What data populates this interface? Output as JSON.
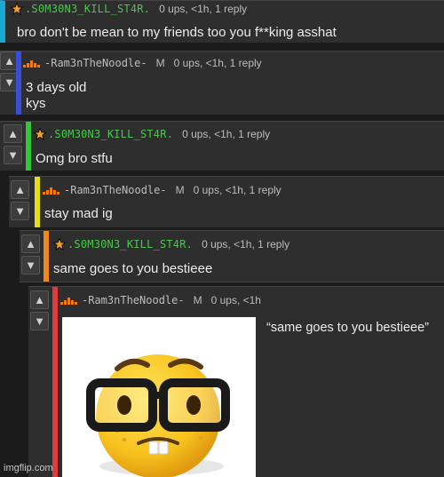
{
  "colors": {
    "bg": "#1b1b1b",
    "panel": "#2e2e2e",
    "blue": "#1aa7d1",
    "indigo": "#3a4fd6",
    "green": "#33c53a",
    "yellow": "#e5dc1a",
    "orange": "#f08a1c",
    "red": "#e23b3b",
    "username_green": "#45c94a"
  },
  "comments": [
    {
      "username": ".S0M30N3_KILL_ST4R.",
      "stats": "0 ups, <1h, 1 reply",
      "text": "bro don't be mean to my friends too you f**king asshat",
      "user_icon": "star-icon"
    },
    {
      "username": "-Ram3nTheNoodle-",
      "mod": "M",
      "stats": "0 ups, <1h, 1 reply",
      "text_line1": "3 days old",
      "text_line2": "kys",
      "user_icon": "bars-icon"
    },
    {
      "username": ".S0M30N3_KILL_ST4R.",
      "stats": "0 ups, <1h, 1 reply",
      "text": "Omg bro stfu",
      "user_icon": "star-icon"
    },
    {
      "username": "-Ram3nTheNoodle-",
      "mod": "M",
      "stats": "0 ups, <1h, 1 reply",
      "text": "stay mad ig",
      "user_icon": "bars-icon"
    },
    {
      "username": ".S0M30N3_KILL_ST4R.",
      "stats": "0 ups, <1h, 1 reply",
      "text": "same goes to you bestieee",
      "user_icon": "star-icon"
    },
    {
      "username": "-Ram3nTheNoodle-",
      "mod": "M",
      "stats": "0 ups, <1h",
      "quote": "“same goes to you bestieee”",
      "image": "nerd-emoji",
      "user_icon": "bars-icon"
    }
  ],
  "vote_icons": {
    "up": "arrow-up-icon",
    "down": "arrow-down-icon"
  },
  "watermark": "imgflip.com"
}
